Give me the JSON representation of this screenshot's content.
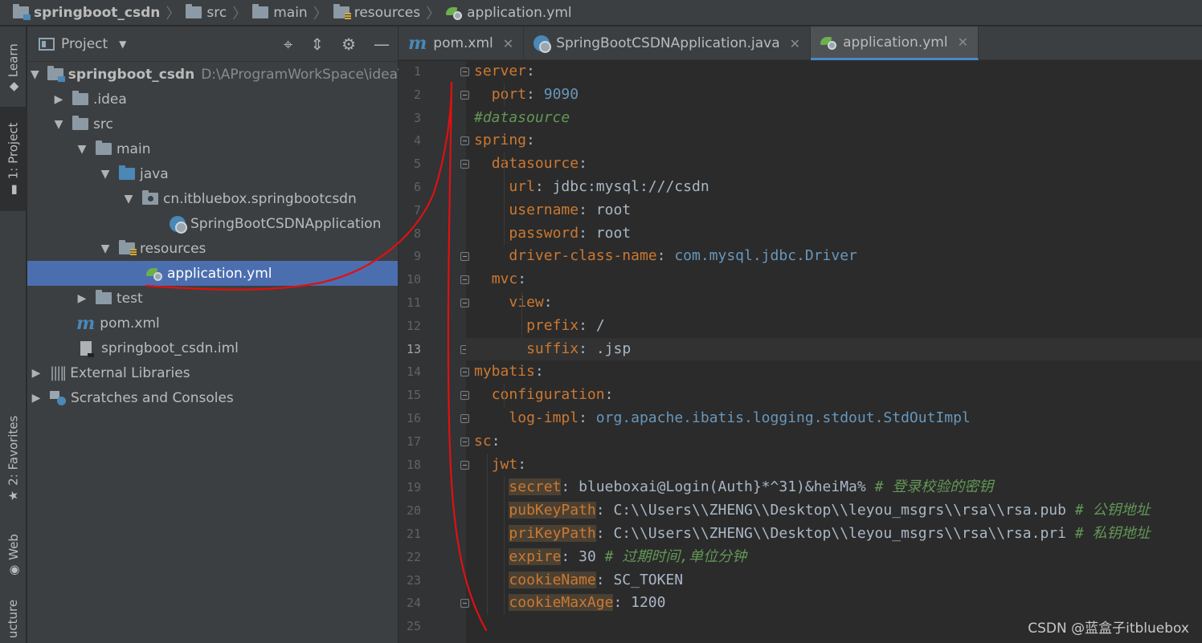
{
  "breadcrumb": [
    "springboot_csdn",
    "src",
    "main",
    "resources",
    "application.yml"
  ],
  "toolstrip": {
    "learn": "Learn",
    "project": "1: Project",
    "favorites": "2: Favorites",
    "web": "Web",
    "structure": "ucture"
  },
  "project_panel": {
    "title": "Project",
    "rows": [
      {
        "label": "springboot_csdn",
        "path": "D:\\AProgramWorkSpace\\idea\\s"
      },
      {
        "label": ".idea"
      },
      {
        "label": "src"
      },
      {
        "label": "main"
      },
      {
        "label": "java"
      },
      {
        "label": "cn.itbluebox.springbootcsdn"
      },
      {
        "label": "SpringBootCSDNApplication"
      },
      {
        "label": "resources"
      },
      {
        "label": "application.yml"
      },
      {
        "label": "test"
      },
      {
        "label": "pom.xml"
      },
      {
        "label": "springboot_csdn.iml"
      },
      {
        "label": "External Libraries"
      },
      {
        "label": "Scratches and Consoles"
      }
    ]
  },
  "tabs": [
    {
      "label": "pom.xml",
      "icon": "maven-icon"
    },
    {
      "label": "SpringBootCSDNApplication.java",
      "icon": "spring-boot-class-icon"
    },
    {
      "label": "application.yml",
      "icon": "spring-yml-icon",
      "active": true
    }
  ],
  "editor": {
    "current_line": 13,
    "lines": [
      {
        "n": "1",
        "key": "server",
        "rest": ":"
      },
      {
        "n": "2",
        "key": "port",
        "rest": ": ",
        "val": "9090",
        "valtype": "num"
      },
      {
        "n": "3",
        "comment": "#datasource"
      },
      {
        "n": "4",
        "key": "spring",
        "rest": ":"
      },
      {
        "n": "5",
        "key": "datasource",
        "rest": ":"
      },
      {
        "n": "6",
        "key": "url",
        "rest": ": ",
        "val": "jdbc:mysql:///csdn"
      },
      {
        "n": "7",
        "key": "username",
        "rest": ": ",
        "val": "root"
      },
      {
        "n": "8",
        "key": "password",
        "rest": ": ",
        "val": "root"
      },
      {
        "n": "9",
        "key": "driver-class-name",
        "rest": ": ",
        "val": "com.mysql.jdbc.Driver",
        "valtype": "cls"
      },
      {
        "n": "10",
        "key": "mvc",
        "rest": ":"
      },
      {
        "n": "11",
        "key": "view",
        "rest": ":"
      },
      {
        "n": "12",
        "key": "prefix",
        "rest": ": ",
        "val": "/"
      },
      {
        "n": "13",
        "key": "suffix",
        "rest": ": ",
        "val": ".jsp"
      },
      {
        "n": "14",
        "key": "mybatis",
        "rest": ":"
      },
      {
        "n": "15",
        "key": "configuration",
        "rest": ":"
      },
      {
        "n": "16",
        "key": "log-impl",
        "rest": ": ",
        "val": "org.apache.ibatis.logging.stdout.StdOutImpl",
        "valtype": "cls"
      },
      {
        "n": "17",
        "key": "sc",
        "rest": ":"
      },
      {
        "n": "18",
        "key": "jwt",
        "rest": ":"
      },
      {
        "n": "19",
        "key": "secret",
        "rest": ": ",
        "val": "blueboxai@Login(Auth}*^31)&heiMa%",
        "tail": " # 登录校验的密钥"
      },
      {
        "n": "20",
        "key": "pubKeyPath",
        "rest": ": ",
        "val": "C:\\\\Users\\\\ZHENG\\\\Desktop\\\\leyou_msgrs\\\\rsa\\\\rsa.pub",
        "tail": " # 公钥地址"
      },
      {
        "n": "21",
        "key": "priKeyPath",
        "rest": ": ",
        "val": "C:\\\\Users\\\\ZHENG\\\\Desktop\\\\leyou_msgrs\\\\rsa\\\\rsa.pri",
        "tail": " # 私钥地址"
      },
      {
        "n": "22",
        "key": "expire",
        "rest": ": ",
        "val": "30",
        "tail": " # 过期时间,单位分钟"
      },
      {
        "n": "23",
        "key": "cookieName",
        "rest": ": ",
        "val": "SC_TOKEN"
      },
      {
        "n": "24",
        "key": "cookieMaxAge",
        "rest": ": ",
        "val": "1200"
      },
      {
        "n": "25"
      }
    ]
  },
  "watermark": "CSDN @蓝盒子itbluebox",
  "colors": {
    "key": "#cc7832",
    "number": "#6897bb",
    "comment": "#629755",
    "selection": "#4b6eaf",
    "annotation": "#e01010"
  }
}
